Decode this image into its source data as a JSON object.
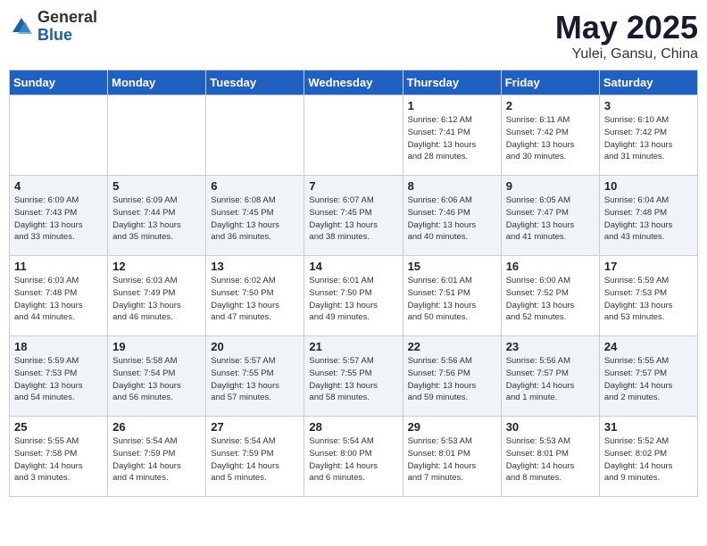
{
  "header": {
    "logo_general": "General",
    "logo_blue": "Blue",
    "title": "May 2025",
    "location": "Yulei, Gansu, China"
  },
  "weekdays": [
    "Sunday",
    "Monday",
    "Tuesday",
    "Wednesday",
    "Thursday",
    "Friday",
    "Saturday"
  ],
  "weeks": [
    [
      {
        "day": "",
        "info": ""
      },
      {
        "day": "",
        "info": ""
      },
      {
        "day": "",
        "info": ""
      },
      {
        "day": "",
        "info": ""
      },
      {
        "day": "1",
        "info": "Sunrise: 6:12 AM\nSunset: 7:41 PM\nDaylight: 13 hours\nand 28 minutes."
      },
      {
        "day": "2",
        "info": "Sunrise: 6:11 AM\nSunset: 7:42 PM\nDaylight: 13 hours\nand 30 minutes."
      },
      {
        "day": "3",
        "info": "Sunrise: 6:10 AM\nSunset: 7:42 PM\nDaylight: 13 hours\nand 31 minutes."
      }
    ],
    [
      {
        "day": "4",
        "info": "Sunrise: 6:09 AM\nSunset: 7:43 PM\nDaylight: 13 hours\nand 33 minutes."
      },
      {
        "day": "5",
        "info": "Sunrise: 6:09 AM\nSunset: 7:44 PM\nDaylight: 13 hours\nand 35 minutes."
      },
      {
        "day": "6",
        "info": "Sunrise: 6:08 AM\nSunset: 7:45 PM\nDaylight: 13 hours\nand 36 minutes."
      },
      {
        "day": "7",
        "info": "Sunrise: 6:07 AM\nSunset: 7:45 PM\nDaylight: 13 hours\nand 38 minutes."
      },
      {
        "day": "8",
        "info": "Sunrise: 6:06 AM\nSunset: 7:46 PM\nDaylight: 13 hours\nand 40 minutes."
      },
      {
        "day": "9",
        "info": "Sunrise: 6:05 AM\nSunset: 7:47 PM\nDaylight: 13 hours\nand 41 minutes."
      },
      {
        "day": "10",
        "info": "Sunrise: 6:04 AM\nSunset: 7:48 PM\nDaylight: 13 hours\nand 43 minutes."
      }
    ],
    [
      {
        "day": "11",
        "info": "Sunrise: 6:03 AM\nSunset: 7:48 PM\nDaylight: 13 hours\nand 44 minutes."
      },
      {
        "day": "12",
        "info": "Sunrise: 6:03 AM\nSunset: 7:49 PM\nDaylight: 13 hours\nand 46 minutes."
      },
      {
        "day": "13",
        "info": "Sunrise: 6:02 AM\nSunset: 7:50 PM\nDaylight: 13 hours\nand 47 minutes."
      },
      {
        "day": "14",
        "info": "Sunrise: 6:01 AM\nSunset: 7:50 PM\nDaylight: 13 hours\nand 49 minutes."
      },
      {
        "day": "15",
        "info": "Sunrise: 6:01 AM\nSunset: 7:51 PM\nDaylight: 13 hours\nand 50 minutes."
      },
      {
        "day": "16",
        "info": "Sunrise: 6:00 AM\nSunset: 7:52 PM\nDaylight: 13 hours\nand 52 minutes."
      },
      {
        "day": "17",
        "info": "Sunrise: 5:59 AM\nSunset: 7:53 PM\nDaylight: 13 hours\nand 53 minutes."
      }
    ],
    [
      {
        "day": "18",
        "info": "Sunrise: 5:59 AM\nSunset: 7:53 PM\nDaylight: 13 hours\nand 54 minutes."
      },
      {
        "day": "19",
        "info": "Sunrise: 5:58 AM\nSunset: 7:54 PM\nDaylight: 13 hours\nand 56 minutes."
      },
      {
        "day": "20",
        "info": "Sunrise: 5:57 AM\nSunset: 7:55 PM\nDaylight: 13 hours\nand 57 minutes."
      },
      {
        "day": "21",
        "info": "Sunrise: 5:57 AM\nSunset: 7:55 PM\nDaylight: 13 hours\nand 58 minutes."
      },
      {
        "day": "22",
        "info": "Sunrise: 5:56 AM\nSunset: 7:56 PM\nDaylight: 13 hours\nand 59 minutes."
      },
      {
        "day": "23",
        "info": "Sunrise: 5:56 AM\nSunset: 7:57 PM\nDaylight: 14 hours\nand 1 minute."
      },
      {
        "day": "24",
        "info": "Sunrise: 5:55 AM\nSunset: 7:57 PM\nDaylight: 14 hours\nand 2 minutes."
      }
    ],
    [
      {
        "day": "25",
        "info": "Sunrise: 5:55 AM\nSunset: 7:58 PM\nDaylight: 14 hours\nand 3 minutes."
      },
      {
        "day": "26",
        "info": "Sunrise: 5:54 AM\nSunset: 7:59 PM\nDaylight: 14 hours\nand 4 minutes."
      },
      {
        "day": "27",
        "info": "Sunrise: 5:54 AM\nSunset: 7:59 PM\nDaylight: 14 hours\nand 5 minutes."
      },
      {
        "day": "28",
        "info": "Sunrise: 5:54 AM\nSunset: 8:00 PM\nDaylight: 14 hours\nand 6 minutes."
      },
      {
        "day": "29",
        "info": "Sunrise: 5:53 AM\nSunset: 8:01 PM\nDaylight: 14 hours\nand 7 minutes."
      },
      {
        "day": "30",
        "info": "Sunrise: 5:53 AM\nSunset: 8:01 PM\nDaylight: 14 hours\nand 8 minutes."
      },
      {
        "day": "31",
        "info": "Sunrise: 5:52 AM\nSunset: 8:02 PM\nDaylight: 14 hours\nand 9 minutes."
      }
    ]
  ]
}
